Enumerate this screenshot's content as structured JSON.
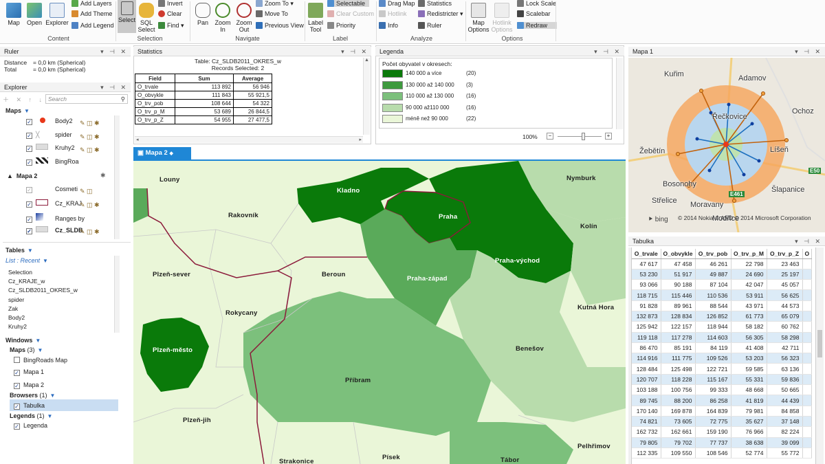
{
  "ribbon": {
    "main": [
      {
        "label": "Map",
        "icon": "map-icon"
      },
      {
        "label": "Open",
        "icon": "open-icon"
      },
      {
        "label": "Explorer",
        "icon": "explorer-icon"
      }
    ],
    "content_small": [
      "Add Layers",
      "Add Theme",
      "Add Legend"
    ],
    "select": "Select",
    "sql": "SQL Select",
    "selection_small": [
      "Invert",
      "Clear",
      "Find"
    ],
    "pan": "Pan",
    "zoom_in": "Zoom In",
    "zoom_out": "Zoom Out",
    "navigate_small": [
      "Zoom To",
      "Move To",
      "Previous View"
    ],
    "label_tool": "Label Tool",
    "label_small": [
      "Selectable",
      "Clear Custom",
      "Hotlink",
      "Priority"
    ],
    "analyze_small": [
      "Drag Map",
      "Statistics",
      "Redistricter",
      "Info",
      "Ruler"
    ],
    "map_options": "Map Options",
    "hotlink_options": "Hotlink Options",
    "options_small": [
      "Lock Scale",
      "Scalebar",
      "Redraw"
    ],
    "groups": [
      "Content",
      "Selection",
      "Navigate",
      "Label",
      "Analyze",
      "Options"
    ]
  },
  "ruler": {
    "title": "Ruler",
    "distance_label": "Distance",
    "distance": "= 0,0 km (Spherical)",
    "total_label": "Total",
    "total": "= 0,0 km (Spherical)"
  },
  "explorer": {
    "title": "Explorer",
    "search_placeholder": "Search",
    "maps_header": "Maps",
    "layers1": [
      "Body2",
      "spider",
      "Kruhy2",
      "BingRoa"
    ],
    "map2": "Mapa 2",
    "layers2": [
      "Cosmeti",
      "Cz_KRAJ",
      "Ranges by",
      "Cz_SLDB"
    ],
    "tables_header": "Tables",
    "list_recent": "List : Recent",
    "tables": [
      "Selection",
      "Cz_KRAJE_w",
      "Cz_SLDB2011_OKRES_w",
      "spider",
      "Zak",
      "Body2",
      "Kruhy2"
    ],
    "windows_header": "Windows",
    "maps_group": "Maps",
    "maps_count": "(3)",
    "windows_maps": [
      "BingRoads Map",
      "Mapa 1",
      "Mapa 2"
    ],
    "browsers_group": "Browsers",
    "browsers_count": "(1)",
    "browsers": [
      "Tabulka"
    ],
    "legends_group": "Legends",
    "legends_count": "(1)",
    "legends": [
      "Legenda"
    ]
  },
  "statistics": {
    "title": "Statistics",
    "table_label": "Table: Cz_SLDB2011_OKRES_w",
    "records": "Records Selected: 2",
    "headers": [
      "Field",
      "Sum",
      "Average"
    ],
    "rows": [
      [
        "O_trvale",
        "113 892",
        "56 946"
      ],
      [
        "O_obvykle",
        "111 843",
        "55 921,5"
      ],
      [
        "O_trv_pob",
        "108 644",
        "54 322"
      ],
      [
        "O_trv_p_M",
        "53 689",
        "26 844,5"
      ],
      [
        "O_trv_p_Z",
        "54 955",
        "27 477,5"
      ]
    ]
  },
  "legend": {
    "title": "Legenda",
    "heading": "Počet obyvatel v okresech:",
    "items": [
      {
        "label": "140 000 a více",
        "count": "(20)",
        "color": "#0a7a0a"
      },
      {
        "label": "130 000 až 140 000",
        "count": "(3)",
        "color": "#3e9a3e"
      },
      {
        "label": "110 000 až 130 000",
        "count": "(16)",
        "color": "#7cc07c"
      },
      {
        "label": "90 000 až110 000",
        "count": "(16)",
        "color": "#b8dcac"
      },
      {
        "label": "méně než 90 000",
        "count": "(22)",
        "color": "#eaf6d8"
      }
    ],
    "zoom": "100%"
  },
  "mapa2": {
    "tab": "Mapa 2",
    "labels": [
      "Louny",
      "Kladno",
      "Nymburk",
      "Rakovník",
      "Praha",
      "Kolín",
      "Praha-východ",
      "Plzeň-sever",
      "Beroun",
      "Praha-západ",
      "Rokycany",
      "Kutná Hora",
      "Plzeň-město",
      "Benešov",
      "Příbram",
      "Plzeň-jih",
      "Pelhřimov",
      "Strakonice",
      "Písek",
      "Tábor"
    ]
  },
  "mapa1": {
    "title": "Mapa 1",
    "places": [
      "Kuřim",
      "Adamov",
      "Ochoz",
      "Žebětín",
      "Bosonohy",
      "Střelice",
      "Moravany",
      "Šlapanice",
      "Modřice",
      "Řečkovice",
      "Líšeň"
    ],
    "roads": [
      "E50",
      "E461"
    ],
    "bing": "bing",
    "copyright": "© 2014 Nokia © AND © 2014 Microsoft Corporation"
  },
  "tabulka": {
    "title": "Tabulka",
    "headers": [
      "O_trvale",
      "O_obvykle",
      "O_trv_pob",
      "O_trv_p_M",
      "O_trv_p_Z",
      "O"
    ],
    "rows": [
      [
        "47 617",
        "47 458",
        "46 261",
        "22 798",
        "23 463"
      ],
      [
        "53 230",
        "51 917",
        "49 887",
        "24 690",
        "25 197"
      ],
      [
        "93 066",
        "90 188",
        "87 104",
        "42 047",
        "45 057"
      ],
      [
        "118 715",
        "115 446",
        "110 536",
        "53 911",
        "56 625"
      ],
      [
        "91 828",
        "89 961",
        "88 544",
        "43 971",
        "44 573"
      ],
      [
        "132 873",
        "128 834",
        "126 852",
        "61 773",
        "65 079"
      ],
      [
        "125 942",
        "122 157",
        "118 944",
        "58 182",
        "60 762"
      ],
      [
        "119 118",
        "117 278",
        "114 603",
        "56 305",
        "58 298"
      ],
      [
        "86 470",
        "85 191",
        "84 119",
        "41 408",
        "42 711"
      ],
      [
        "114 916",
        "111 775",
        "109 526",
        "53 203",
        "56 323"
      ],
      [
        "128 484",
        "125 498",
        "122 721",
        "59 585",
        "63 136"
      ],
      [
        "120 707",
        "118 228",
        "115 167",
        "55 331",
        "59 836"
      ],
      [
        "103 188",
        "100 756",
        "99 333",
        "48 668",
        "50 665"
      ],
      [
        "89 745",
        "88 200",
        "86 258",
        "41 819",
        "44 439"
      ],
      [
        "170 140",
        "169 878",
        "164 839",
        "79 981",
        "84 858"
      ],
      [
        "74 821",
        "73 605",
        "72 775",
        "35 627",
        "37 148"
      ],
      [
        "162 732",
        "162 661",
        "159 190",
        "76 966",
        "82 224"
      ],
      [
        "79 805",
        "79 702",
        "77 737",
        "38 638",
        "39 099"
      ],
      [
        "112 335",
        "109 550",
        "108 546",
        "52 774",
        "55 772"
      ]
    ]
  }
}
